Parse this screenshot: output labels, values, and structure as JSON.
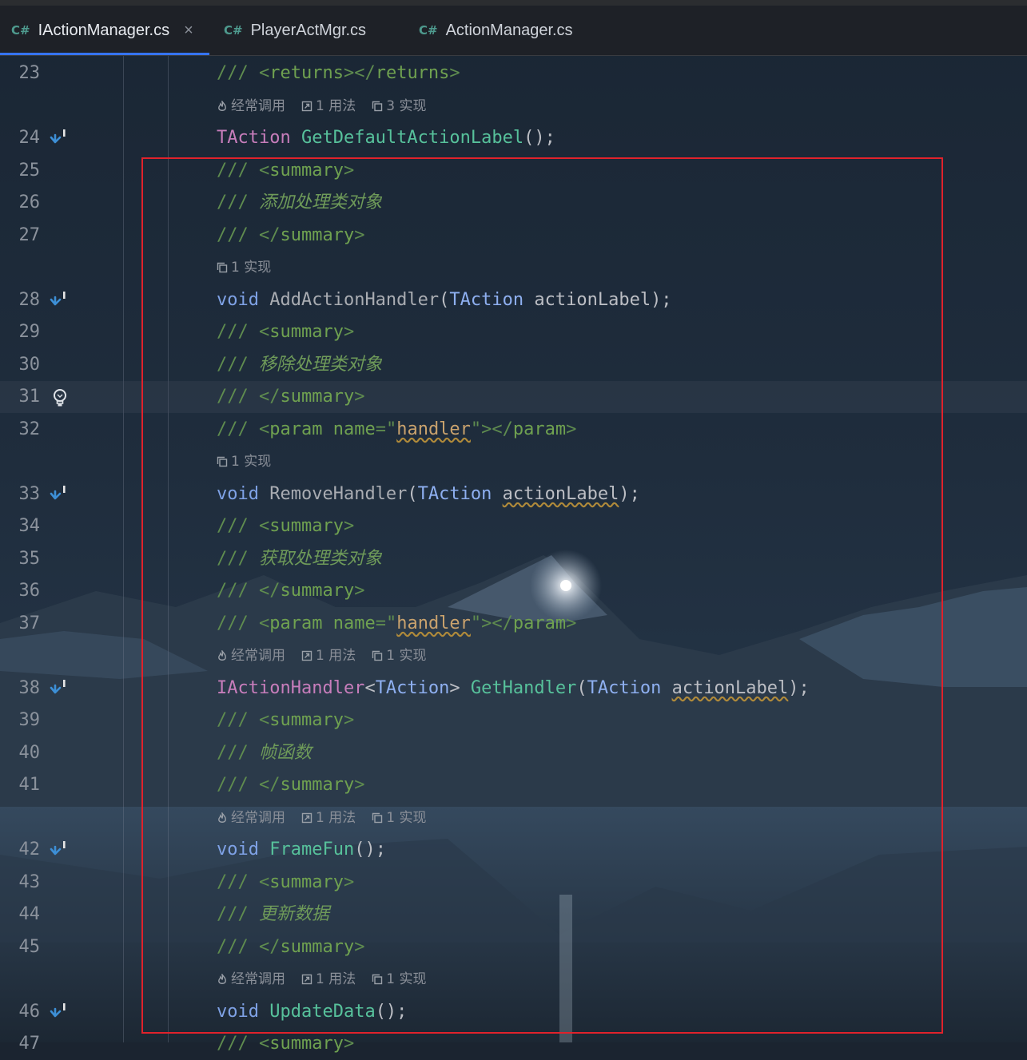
{
  "tabs": [
    {
      "badge": "C#",
      "label": "IActionManager.cs",
      "close": "×",
      "active": true
    },
    {
      "badge": "C#",
      "label": "PlayerActMgr.cs",
      "active": false
    },
    {
      "badge": "C#",
      "label": "ActionManager.cs",
      "active": false
    }
  ],
  "icons": {
    "gutter_implemented": "implemented-arrow-icon",
    "gutter_bulb": "lightbulb-icon",
    "hint_frequent": "flame-icon",
    "hint_usage": "usage-arrow-icon",
    "hint_impl": "implementation-icon"
  },
  "colors": {
    "tab_underline": "#3574f0",
    "highlight_box": "#e0222b"
  },
  "lines": [
    {
      "num": "23",
      "tokens": [
        {
          "t": "/// ",
          "c": "com"
        },
        {
          "t": "<",
          "c": "com"
        },
        {
          "t": "returns",
          "c": "tag"
        },
        {
          "t": "></",
          "c": "com"
        },
        {
          "t": "returns",
          "c": "tag"
        },
        {
          "t": ">",
          "c": "com"
        }
      ]
    },
    {
      "hint": [
        {
          "icon": "flame",
          "text": "经常调用"
        },
        {
          "icon": "usage",
          "text": "1 用法"
        },
        {
          "icon": "impl",
          "text": "3 实现"
        }
      ]
    },
    {
      "num": "24",
      "gutter": "impl",
      "tokens": [
        {
          "t": "TAction",
          "c": "tp"
        },
        {
          "t": " "
        },
        {
          "t": "GetDefaultActionLabel",
          "c": "fn"
        },
        {
          "t": "();"
        }
      ]
    },
    {
      "num": "25",
      "tokens": [
        {
          "t": "/// ",
          "c": "com"
        },
        {
          "t": "<",
          "c": "com"
        },
        {
          "t": "summary",
          "c": "tag"
        },
        {
          "t": ">",
          "c": "com"
        }
      ]
    },
    {
      "num": "26",
      "tokens": [
        {
          "t": "/// ",
          "c": "com"
        },
        {
          "t": "添加处理类对象",
          "c": "doc"
        }
      ]
    },
    {
      "num": "27",
      "tokens": [
        {
          "t": "/// ",
          "c": "com"
        },
        {
          "t": "</",
          "c": "com"
        },
        {
          "t": "summary",
          "c": "tag"
        },
        {
          "t": ">",
          "c": "com"
        }
      ]
    },
    {
      "hint": [
        {
          "icon": "impl",
          "text": "1 实现"
        }
      ]
    },
    {
      "num": "28",
      "gutter": "impl",
      "tokens": [
        {
          "t": "void",
          "c": "kw"
        },
        {
          "t": " "
        },
        {
          "t": "AddActionHandler",
          "c": "fng"
        },
        {
          "t": "("
        },
        {
          "t": "TAction",
          "c": "ty"
        },
        {
          "t": " actionLabel);"
        }
      ]
    },
    {
      "num": "29",
      "tokens": [
        {
          "t": "/// ",
          "c": "com"
        },
        {
          "t": "<",
          "c": "com"
        },
        {
          "t": "summary",
          "c": "tag"
        },
        {
          "t": ">",
          "c": "com"
        }
      ]
    },
    {
      "num": "30",
      "tokens": [
        {
          "t": "/// ",
          "c": "com"
        },
        {
          "t": "移除处理类对象",
          "c": "doc"
        }
      ]
    },
    {
      "num": "31",
      "gutter": "bulb",
      "current": true,
      "tokens": [
        {
          "t": "/// ",
          "c": "com"
        },
        {
          "t": "</",
          "c": "com"
        },
        {
          "t": "summary",
          "c": "tag"
        },
        {
          "t": ">",
          "c": "com"
        }
      ]
    },
    {
      "num": "32",
      "tokens": [
        {
          "t": "/// ",
          "c": "com"
        },
        {
          "t": "<",
          "c": "com"
        },
        {
          "t": "param",
          "c": "tag"
        },
        {
          "t": " ",
          "c": "com"
        },
        {
          "t": "name",
          "c": "tag"
        },
        {
          "t": "=\"",
          "c": "com"
        },
        {
          "t": "handler",
          "c": "str",
          "sq": true
        },
        {
          "t": "\"></",
          "c": "com"
        },
        {
          "t": "param",
          "c": "tag"
        },
        {
          "t": ">",
          "c": "com"
        }
      ]
    },
    {
      "hint": [
        {
          "icon": "impl",
          "text": "1 实现"
        }
      ]
    },
    {
      "num": "33",
      "gutter": "impl",
      "tokens": [
        {
          "t": "void",
          "c": "kw"
        },
        {
          "t": " "
        },
        {
          "t": "RemoveHandler",
          "c": "fng"
        },
        {
          "t": "("
        },
        {
          "t": "TAction",
          "c": "ty"
        },
        {
          "t": " "
        },
        {
          "t": "actionLabel",
          "sq": true
        },
        {
          "t": ");"
        }
      ]
    },
    {
      "num": "34",
      "tokens": [
        {
          "t": "/// ",
          "c": "com"
        },
        {
          "t": "<",
          "c": "com"
        },
        {
          "t": "summary",
          "c": "tag"
        },
        {
          "t": ">",
          "c": "com"
        }
      ]
    },
    {
      "num": "35",
      "tokens": [
        {
          "t": "/// ",
          "c": "com"
        },
        {
          "t": "获取处理类对象",
          "c": "doc"
        }
      ]
    },
    {
      "num": "36",
      "tokens": [
        {
          "t": "/// ",
          "c": "com"
        },
        {
          "t": "</",
          "c": "com"
        },
        {
          "t": "summary",
          "c": "tag"
        },
        {
          "t": ">",
          "c": "com"
        }
      ]
    },
    {
      "num": "37",
      "tokens": [
        {
          "t": "/// ",
          "c": "com"
        },
        {
          "t": "<",
          "c": "com"
        },
        {
          "t": "param",
          "c": "tag"
        },
        {
          "t": " ",
          "c": "com"
        },
        {
          "t": "name",
          "c": "tag"
        },
        {
          "t": "=\"",
          "c": "com"
        },
        {
          "t": "handler",
          "c": "str",
          "sq": true
        },
        {
          "t": "\"></",
          "c": "com"
        },
        {
          "t": "param",
          "c": "tag"
        },
        {
          "t": ">",
          "c": "com"
        }
      ]
    },
    {
      "hint": [
        {
          "icon": "flame",
          "text": "经常调用"
        },
        {
          "icon": "usage",
          "text": "1 用法"
        },
        {
          "icon": "impl",
          "text": "1 实现"
        }
      ]
    },
    {
      "num": "38",
      "gutter": "impl",
      "tokens": [
        {
          "t": "IActionHandler",
          "c": "tp"
        },
        {
          "t": "<"
        },
        {
          "t": "TAction",
          "c": "ty"
        },
        {
          "t": "> "
        },
        {
          "t": "GetHandler",
          "c": "fn"
        },
        {
          "t": "("
        },
        {
          "t": "TAction",
          "c": "ty"
        },
        {
          "t": " "
        },
        {
          "t": "actionLabel",
          "sq": true
        },
        {
          "t": ");"
        }
      ]
    },
    {
      "num": "39",
      "tokens": [
        {
          "t": "/// ",
          "c": "com"
        },
        {
          "t": "<",
          "c": "com"
        },
        {
          "t": "summary",
          "c": "tag"
        },
        {
          "t": ">",
          "c": "com"
        }
      ]
    },
    {
      "num": "40",
      "tokens": [
        {
          "t": "/// ",
          "c": "com"
        },
        {
          "t": "帧函数",
          "c": "doc"
        }
      ]
    },
    {
      "num": "41",
      "tokens": [
        {
          "t": "/// ",
          "c": "com"
        },
        {
          "t": "</",
          "c": "com"
        },
        {
          "t": "summary",
          "c": "tag"
        },
        {
          "t": ">",
          "c": "com"
        }
      ]
    },
    {
      "hint": [
        {
          "icon": "flame",
          "text": "经常调用"
        },
        {
          "icon": "usage",
          "text": "1 用法"
        },
        {
          "icon": "impl",
          "text": "1 实现"
        }
      ]
    },
    {
      "num": "42",
      "gutter": "impl",
      "tokens": [
        {
          "t": "void",
          "c": "kw"
        },
        {
          "t": " "
        },
        {
          "t": "FrameFun",
          "c": "fn"
        },
        {
          "t": "();"
        }
      ]
    },
    {
      "num": "43",
      "tokens": [
        {
          "t": "/// ",
          "c": "com"
        },
        {
          "t": "<",
          "c": "com"
        },
        {
          "t": "summary",
          "c": "tag"
        },
        {
          "t": ">",
          "c": "com"
        }
      ]
    },
    {
      "num": "44",
      "tokens": [
        {
          "t": "/// ",
          "c": "com"
        },
        {
          "t": "更新数据",
          "c": "doc"
        }
      ]
    },
    {
      "num": "45",
      "tokens": [
        {
          "t": "/// ",
          "c": "com"
        },
        {
          "t": "</",
          "c": "com"
        },
        {
          "t": "summary",
          "c": "tag"
        },
        {
          "t": ">",
          "c": "com"
        }
      ]
    },
    {
      "hint": [
        {
          "icon": "flame",
          "text": "经常调用"
        },
        {
          "icon": "usage",
          "text": "1 用法"
        },
        {
          "icon": "impl",
          "text": "1 实现"
        }
      ]
    },
    {
      "num": "46",
      "gutter": "impl",
      "tokens": [
        {
          "t": "void",
          "c": "kw"
        },
        {
          "t": " "
        },
        {
          "t": "UpdateData",
          "c": "fn"
        },
        {
          "t": "();"
        }
      ]
    },
    {
      "num": "47",
      "tokens": [
        {
          "t": "/// ",
          "c": "com"
        },
        {
          "t": "<",
          "c": "com"
        },
        {
          "t": "summary",
          "c": "tag"
        },
        {
          "t": ">",
          "c": "com"
        }
      ]
    }
  ]
}
